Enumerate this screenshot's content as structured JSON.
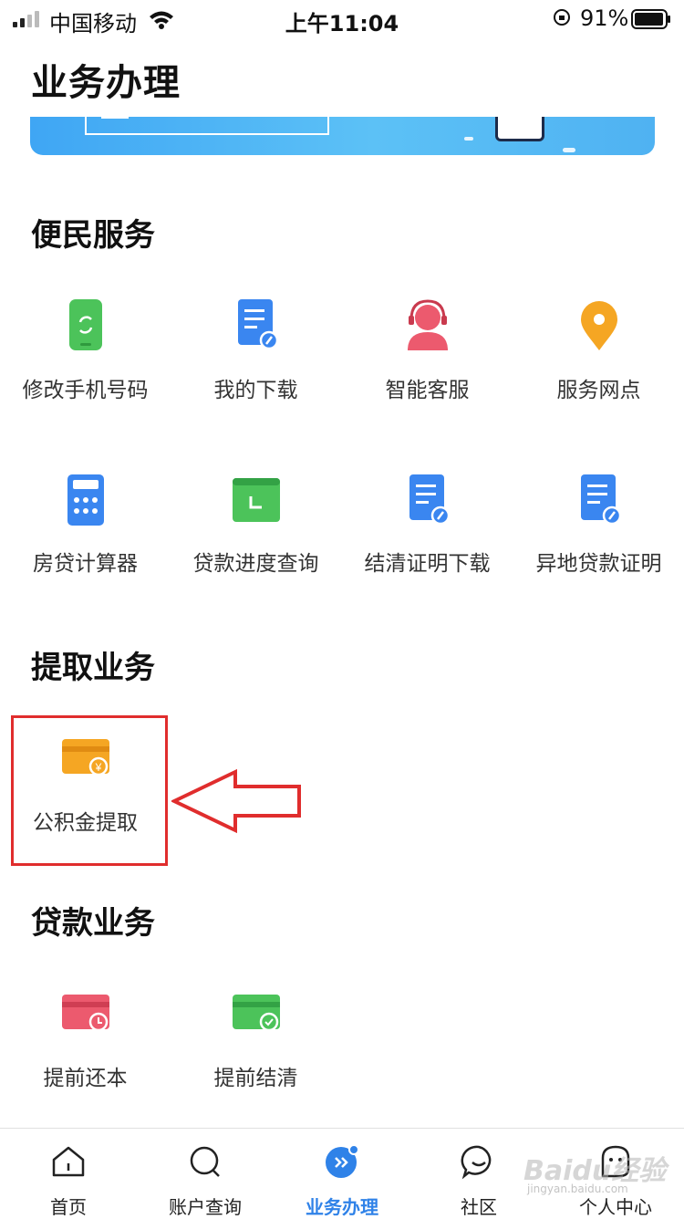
{
  "status_bar": {
    "carrier": "中国移动",
    "time": "上午11:04",
    "battery": "91%"
  },
  "page_title": "业务办理",
  "sections": {
    "convenience": {
      "title": "便民服务",
      "items": [
        {
          "label": "修改手机号码",
          "icon": "phone-refresh-icon"
        },
        {
          "label": "我的下载",
          "icon": "document-download-icon"
        },
        {
          "label": "智能客服",
          "icon": "customer-service-icon"
        },
        {
          "label": "服务网点",
          "icon": "location-pin-icon"
        },
        {
          "label": "房贷计算器",
          "icon": "calculator-icon"
        },
        {
          "label": "贷款进度查询",
          "icon": "loan-progress-icon"
        },
        {
          "label": "结清证明下载",
          "icon": "document-icon"
        },
        {
          "label": "异地贷款证明",
          "icon": "document-icon"
        }
      ]
    },
    "withdrawal": {
      "title": "提取业务",
      "items": [
        {
          "label": "公积金提取",
          "icon": "card-yuan-icon"
        }
      ]
    },
    "loan": {
      "title": "贷款业务",
      "items": [
        {
          "label": "提前还本",
          "icon": "card-clock-icon"
        },
        {
          "label": "提前结清",
          "icon": "card-check-icon"
        }
      ]
    }
  },
  "tabbar": {
    "items": [
      {
        "label": "首页",
        "icon": "home-icon"
      },
      {
        "label": "账户查询",
        "icon": "search-icon"
      },
      {
        "label": "业务办理",
        "icon": "business-icon"
      },
      {
        "label": "社区",
        "icon": "chat-icon"
      },
      {
        "label": "个人中心",
        "icon": "profile-icon"
      }
    ],
    "active_index": 2
  },
  "colors": {
    "accent": "#2f82e8",
    "highlight": "#e02d2d",
    "green": "#4cc35a",
    "blue": "#3a86f0",
    "orange": "#f5a623",
    "red": "#ec5a6e"
  },
  "watermark": {
    "logo": "Baidu经验",
    "url": "jingyan.baidu.com"
  }
}
